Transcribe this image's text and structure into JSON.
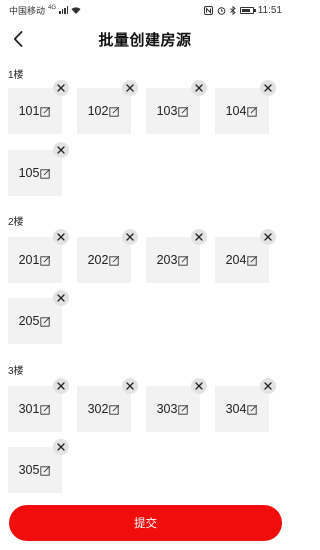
{
  "status_bar": {
    "carrier": "中国移动",
    "network": "4G",
    "time": "11:51"
  },
  "header": {
    "title": "批量创建房源"
  },
  "floors": [
    {
      "label": "1楼",
      "rooms": [
        "101",
        "102",
        "103",
        "104",
        "105"
      ]
    },
    {
      "label": "2楼",
      "rooms": [
        "201",
        "202",
        "203",
        "204",
        "205"
      ]
    },
    {
      "label": "3楼",
      "rooms": [
        "301",
        "302",
        "303",
        "304",
        "305"
      ]
    }
  ],
  "footer": {
    "submit_label": "提交"
  },
  "colors": {
    "accent": "#f20d0d",
    "tile_bg": "#f2f2f2",
    "delete_badge_bg": "#e3e3e3"
  }
}
